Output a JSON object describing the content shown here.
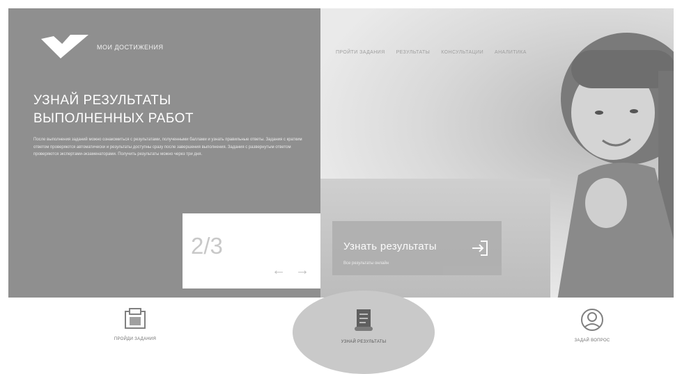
{
  "brand": {
    "name": "МОИ ДОСТИЖЕНИЯ",
    "logo_icon": "checkmark-logo-icon"
  },
  "nav": {
    "items": [
      {
        "label": "ПРОЙТИ ЗАДАНИЯ"
      },
      {
        "label": "РЕЗУЛЬТАТЫ"
      },
      {
        "label": "КОНСУЛЬТАЦИИ"
      },
      {
        "label": "АНАЛИТИКА"
      }
    ]
  },
  "hero": {
    "title_line1": "УЗНАЙ РЕЗУЛЬТАТЫ",
    "title_line2": "ВЫПОЛНЕННЫХ РАБОТ",
    "text": "После выполнения заданий можно ознакомиться с результатами, полученными баллами и узнать правильные ответы. Задания с кратким ответом проверяются автоматически и результаты доступны сразу после завершения выполнения. Задания с развернутым ответом проверяются экспертами-экзаменаторами. Получить результаты можно через три дня.",
    "slide_counter": "2/3",
    "prev_icon": "arrow-left-icon",
    "next_icon": "arrow-right-icon"
  },
  "cta": {
    "title": "Узнать результаты",
    "subtitle": "Все результаты онлайн",
    "icon": "login-arrow-icon"
  },
  "bottom_tabs": [
    {
      "label": "ПРОЙДИ ЗАДАНИЯ",
      "icon": "tasks-icon"
    },
    {
      "label": "УЗНАЙ РЕЗУЛЬТАТЫ",
      "icon": "scroll-document-icon",
      "active": true
    },
    {
      "label": "ЗАДАЙ ВОПРОС",
      "icon": "question-person-icon"
    }
  ],
  "colors": {
    "panel": "#8f8f8f",
    "white": "#ffffff",
    "cta": "#b0b0b0"
  }
}
